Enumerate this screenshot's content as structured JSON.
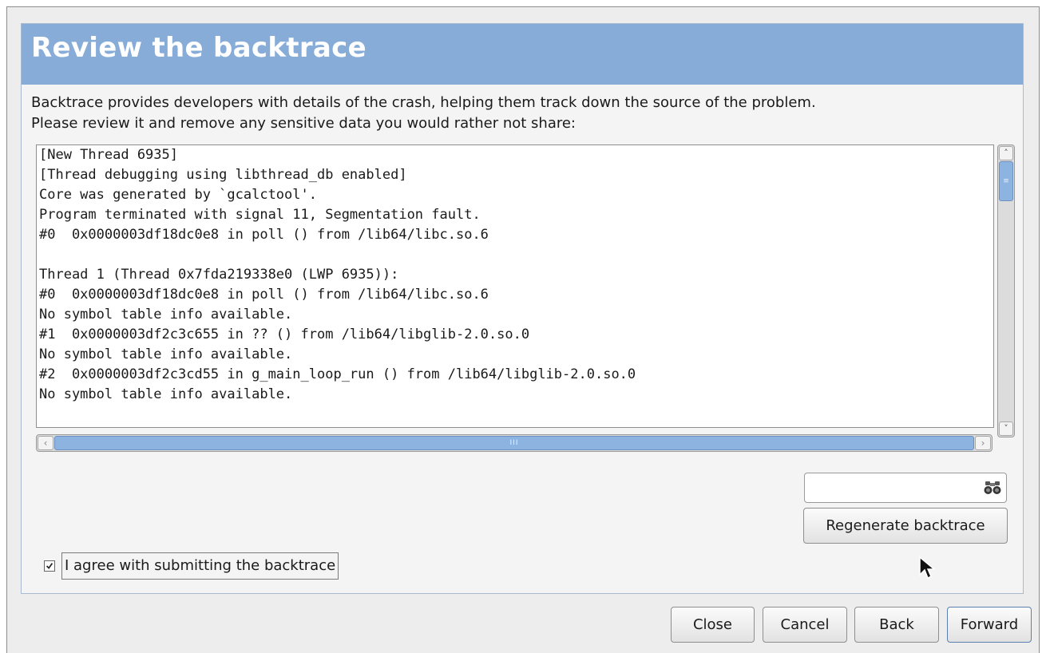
{
  "banner": {
    "title": "Review the backtrace"
  },
  "description": {
    "line1": "Backtrace provides developers with details of the crash, helping them track down the source of the problem.",
    "line2": "Please review it and remove any sensitive data you would rather not share:"
  },
  "backtrace": {
    "lines": [
      "[New Thread 6935]",
      "[Thread debugging using libthread_db enabled]",
      "Core was generated by `gcalctool'.",
      "Program terminated with signal 11, Segmentation fault.",
      "#0  0x0000003df18dc0e8 in poll () from /lib64/libc.so.6",
      "",
      "Thread 1 (Thread 0x7fda219338e0 (LWP 6935)):",
      "#0  0x0000003df18dc0e8 in poll () from /lib64/libc.so.6",
      "No symbol table info available.",
      "#1  0x0000003df2c3c655 in ?? () from /lib64/libglib-2.0.so.0",
      "No symbol table info available.",
      "#2  0x0000003df2c3cd55 in g_main_loop_run () from /lib64/libglib-2.0.so.0",
      "No symbol table info available."
    ]
  },
  "search": {
    "value": "",
    "icon": "binoculars-icon"
  },
  "buttons": {
    "regenerate": "Regenerate backtrace",
    "close": "Close",
    "cancel": "Cancel",
    "back": "Back",
    "forward": "Forward"
  },
  "agree": {
    "label": "I agree with submitting the backtrace",
    "checked": true
  },
  "colors": {
    "banner": "#87acd8",
    "scroll_thumb": "#8db3e0"
  }
}
